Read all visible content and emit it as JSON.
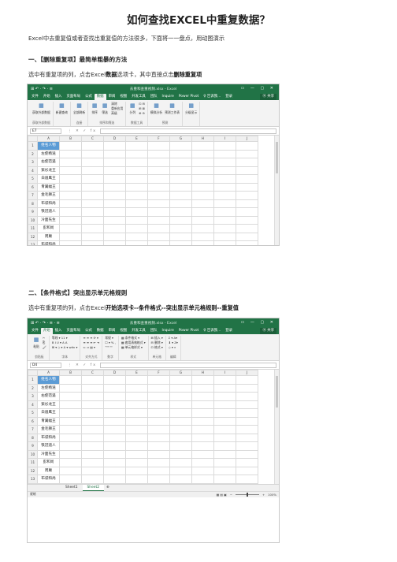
{
  "article": {
    "title": "如何查找EXCEL中重复数据？",
    "intro": "Excel中去重复值或者查找出重复值的方法很多，下面将一一盘点，用动图演示",
    "s1_heading": "一、【删除重复项】最简单粗暴的方法",
    "s1_text_pre": "选中有重复项的列，点击Excel",
    "s1_text_b1": "数据",
    "s1_text_mid": "选项卡，其中直接点击",
    "s1_text_b2": "删除重复项",
    "s2_heading": "二、【条件格式】突出显示单元格规则",
    "s2_text_pre": "选中有重复项的列，点击Excel",
    "s2_text_b": "开始选项卡--条件格式--突出显示单元格规则--重复值"
  },
  "excel1": {
    "window_title": "去重和查重视频.xlsx - Excel",
    "quick_access": "⊞ ↶ · ↷ · ≡",
    "window_controls": "▭ — ▢ ✕",
    "tabs": [
      "文件",
      "开始",
      "插入",
      "页面布局",
      "公式",
      "数据",
      "审阅",
      "视图",
      "开发工具",
      "团队",
      "Inquire",
      "Power Pivot",
      "♀ 告诉我...",
      "登录",
      "Ⓡ 共享"
    ],
    "active_tab": "数据",
    "ribbon_groups": [
      {
        "label": "获取外部数据",
        "buttons": [
          "获取外部数据"
        ]
      },
      {
        "label": "",
        "buttons": [
          "新建查询"
        ]
      },
      {
        "label": "连接",
        "buttons": [
          "全部刷新"
        ]
      },
      {
        "label": "排序和筛选",
        "buttons": [
          "排序",
          "筛选"
        ],
        "small": [
          "清除",
          "重新应用",
          "高级"
        ]
      },
      {
        "label": "数据工具",
        "buttons": [
          "分列"
        ],
        "small": [
          "⊡ ⊟",
          "⊞ ⊠",
          "⊕ ⊖"
        ]
      },
      {
        "label": "预测",
        "buttons": [
          "模拟分析",
          "预测工作表"
        ]
      },
      {
        "label": "",
        "buttons": [
          "分级显示"
        ]
      }
    ],
    "name_box": "E7",
    "fx_buttons": "⋮ ✕ ✓ fx",
    "columns": [
      "A",
      "B",
      "C",
      "D",
      "E",
      "F",
      "G",
      "H",
      "I",
      "J"
    ],
    "rows": [
      "姓名人物",
      "左使杨逍",
      "右使范遥",
      "紫衫龙王",
      "白眉鹰王",
      "青翼蝠王",
      "金毛狮王",
      "布袋和尚",
      "铁冠道人",
      "冷面先生",
      "彭和尚",
      "周颠",
      "布袋和尚"
    ],
    "sheets": [
      "Sheet1",
      "Sheet2"
    ],
    "active_sheet": "Sheet2",
    "plus": "⊕",
    "status_left": "选定目标区域，然后按 ENTER 或选择“粘贴”",
    "zoom": "100%"
  },
  "excel2": {
    "window_title": "去重和查重视频.xlsx - Excel",
    "quick_access": "⊞ ↶ · ↷ · ≡ · ≡",
    "window_controls": "▭ — ▢ ✕",
    "tabs": [
      "文件",
      "开始",
      "插入",
      "页面布局",
      "公式",
      "数据",
      "审阅",
      "视图",
      "开发工具",
      "团队",
      "Inquire",
      "Power Pivot",
      "♀ 告诉我...",
      "登录",
      "Ⓡ 共享"
    ],
    "active_tab": "开始",
    "ribbon_groups": [
      {
        "label": "剪贴板",
        "buttons": [
          "粘贴"
        ],
        "small": [
          "✂",
          "⎘",
          "🖌"
        ]
      },
      {
        "label": "字体",
        "buttons": [],
        "small": [
          "等线 ▾  11 ▾",
          "B I U ▾ A A",
          "⊞ ▾ ◇ ▾ A ▾ wén ▾"
        ]
      },
      {
        "label": "对齐方式",
        "buttons": [],
        "small": [
          "≡ ≡ ≡ ⟳ ▾",
          "≡ ≡ ≡ ⇤ ⇥",
          "⇐ ⇒ ▤ ▾"
        ]
      },
      {
        "label": "数字",
        "buttons": [],
        "small": [
          "常规 ▾",
          "☐ ▾ % ,",
          "⁺⁰⁰ ⁰⁰"
        ]
      },
      {
        "label": "样式",
        "buttons": [],
        "small": [
          "▦ 条件格式 ▾",
          "▦ 套用表格格式 ▾",
          "▦ 单元格样式 ▾"
        ]
      },
      {
        "label": "单元格",
        "buttons": [],
        "small": [
          "⊞ 插入 ▾",
          "⊟ 删除 ▾",
          "⊡ 格式 ▾"
        ]
      },
      {
        "label": "编辑",
        "buttons": [],
        "small": [
          "Σ ▾  A▾",
          "⬇ ▾  Z▾",
          "◇ ▾  ⌕"
        ]
      }
    ],
    "name_box": "D4",
    "fx_buttons": "⋮ ✕ ✓ fx",
    "columns": [
      "A",
      "B",
      "C",
      "D",
      "E",
      "F",
      "G",
      "H",
      "I",
      "J"
    ],
    "rows": [
      "姓名人物",
      "左使杨逍",
      "右使范遥",
      "紫衫龙王",
      "白眉鹰王",
      "青翼蝠王",
      "金毛狮王",
      "布袋和尚",
      "铁冠道人",
      "冷面先生",
      "彭和尚",
      "周颠",
      "布袋和尚"
    ],
    "sheets": [
      "Sheet1",
      "Sheet2"
    ],
    "active_sheet": "Sheet2",
    "plus": "⊕",
    "status_left": "就绪",
    "zoom": "100%"
  }
}
